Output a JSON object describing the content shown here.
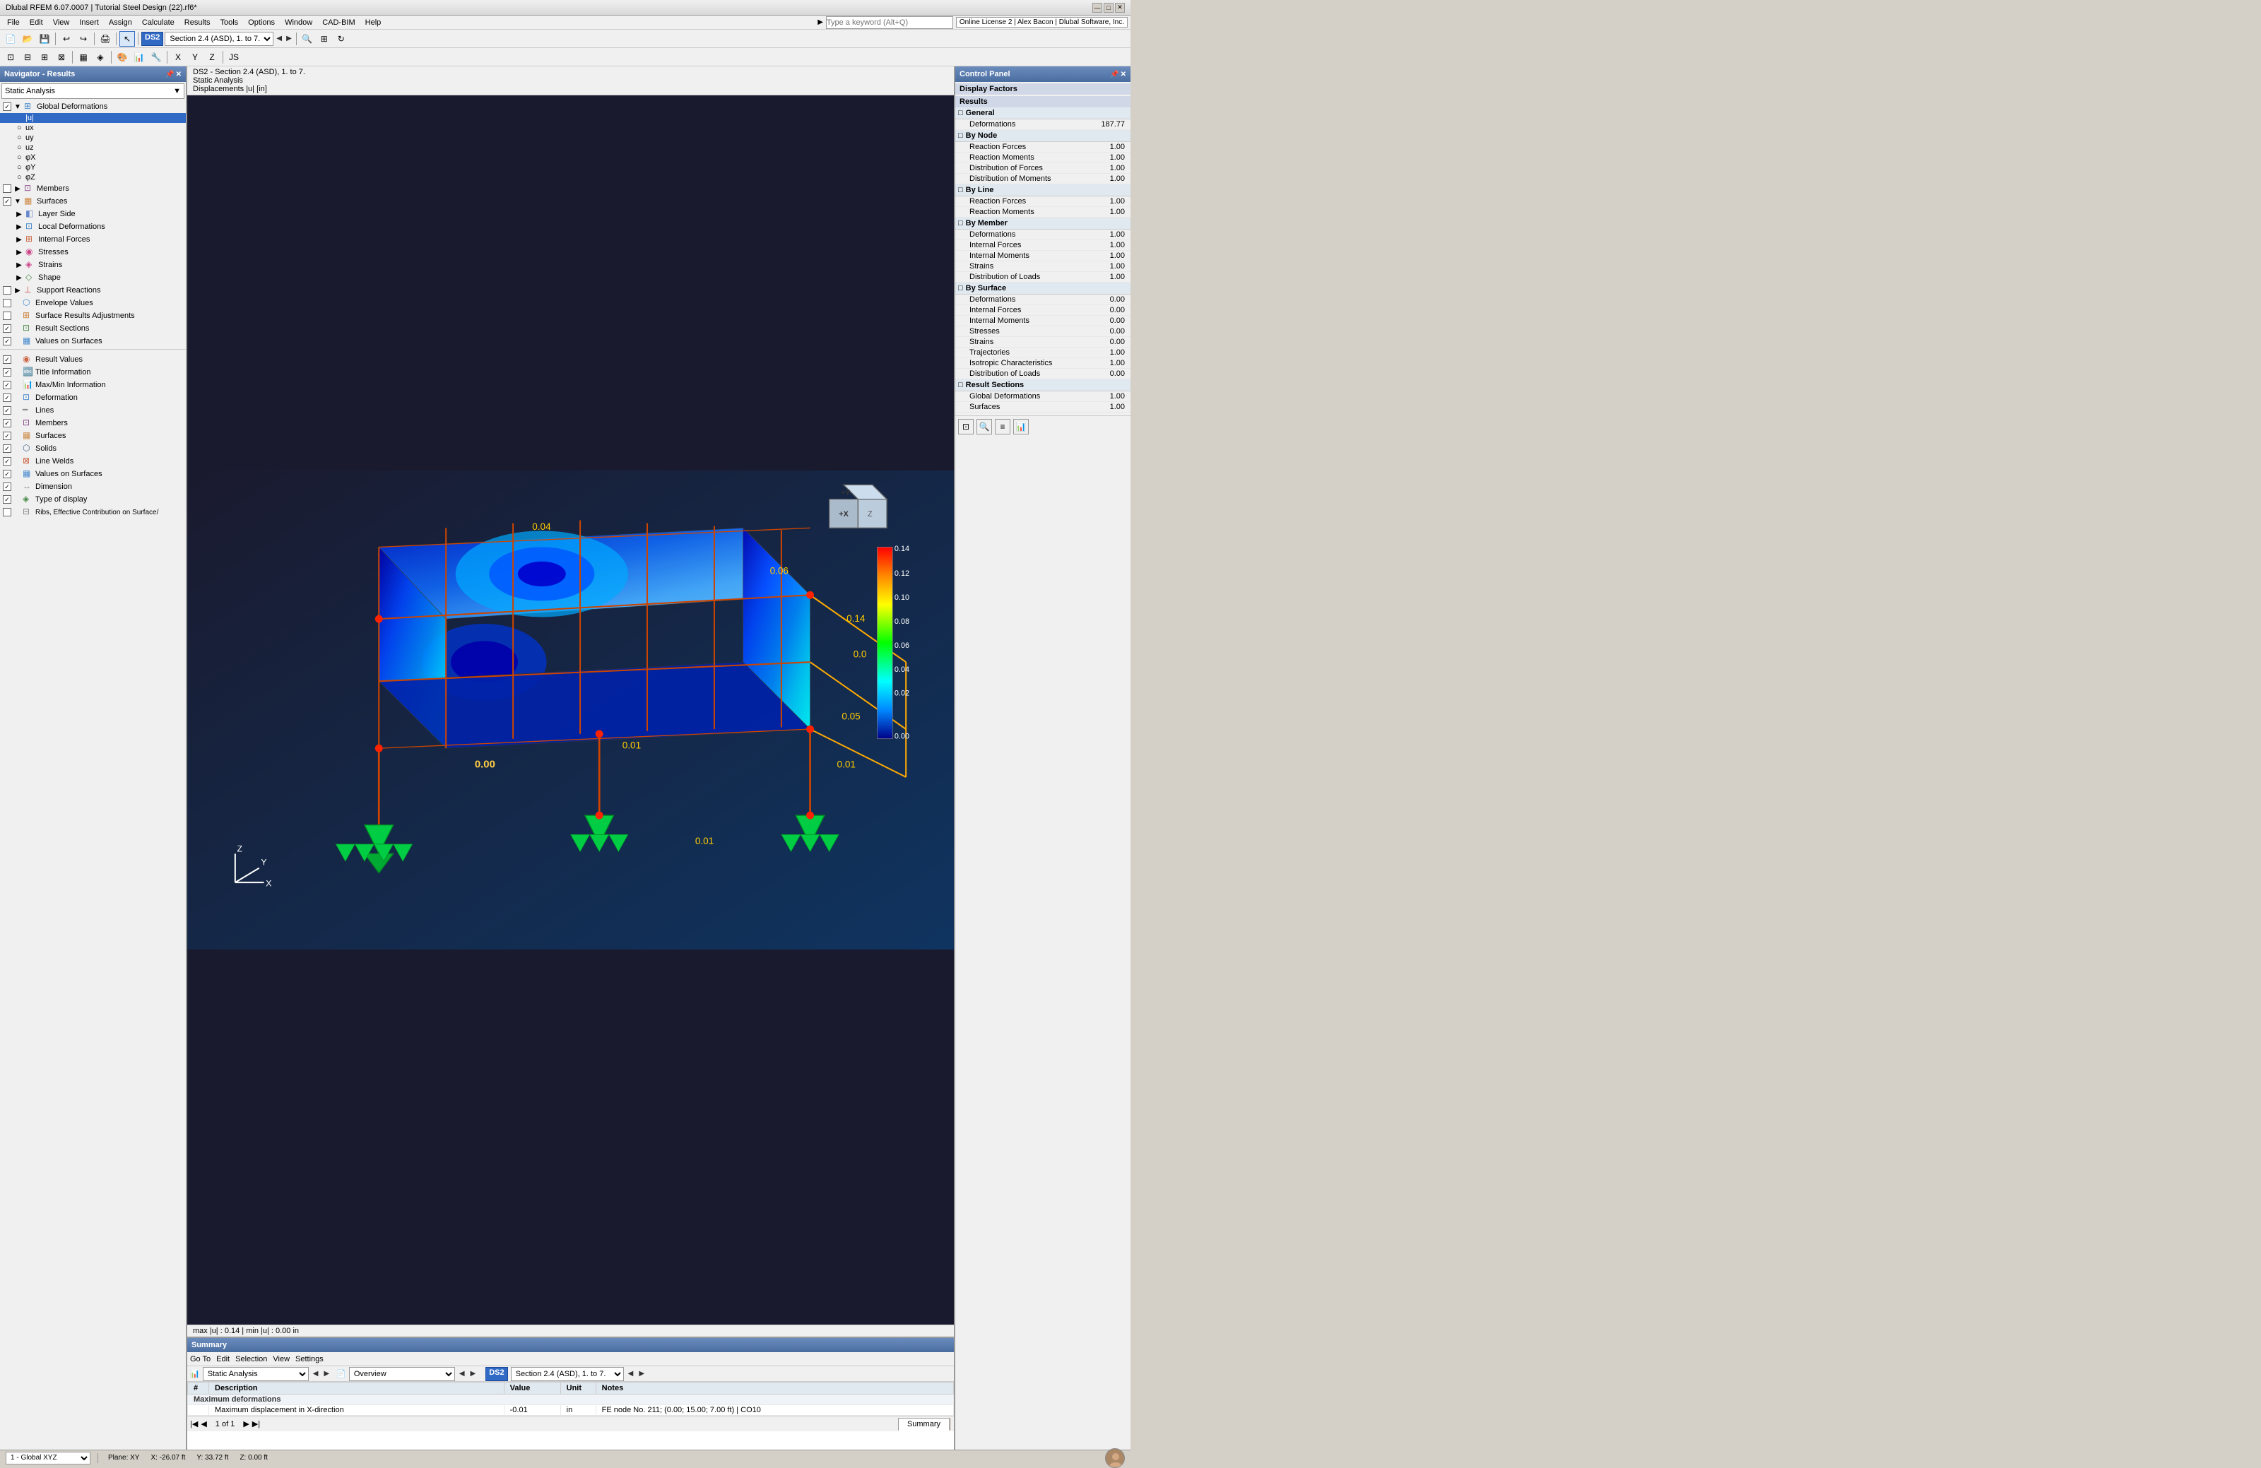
{
  "titleBar": {
    "title": "Dlubal RFEM 6.07.0007 | Tutorial Steel Design (22).rf6*",
    "winButtons": [
      "—",
      "□",
      "✕"
    ]
  },
  "menuBar": {
    "items": [
      "File",
      "Edit",
      "View",
      "Insert",
      "Assign",
      "Calculate",
      "Results",
      "Tools",
      "Options",
      "Window",
      "CAD-BIM",
      "Help"
    ]
  },
  "toolbar1": {
    "searchPlaceholder": "Type a keyword (Alt+Q)",
    "licenseInfo": "Online License 2 | Alex Bacon | Dlubal Software, Inc."
  },
  "viewportHeader": {
    "line1": "DS2 - Section 2.4 (ASD), 1. to 7.",
    "line2": "Static Analysis",
    "line3": "Displacements |u| [in]"
  },
  "viewportFooter": {
    "text": "max |u| : 0.14 | min |u| : 0.00 in"
  },
  "dsCombo": "DS2",
  "sectionCombo": "Section 2.4 (ASD), 1. to 7.",
  "navigatorTitle": "Navigator - Results",
  "navDropdown": "Static Analysis",
  "navTree": [
    {
      "id": "global-deformations",
      "label": "Global Deformations",
      "level": 0,
      "checked": true,
      "expanded": true,
      "hasExpand": true
    },
    {
      "id": "u",
      "label": "|u|",
      "level": 1,
      "radio": true,
      "selected": true
    },
    {
      "id": "ux",
      "label": "ux",
      "level": 1,
      "radio": true
    },
    {
      "id": "uy",
      "label": "uy",
      "level": 1,
      "radio": true
    },
    {
      "id": "uz",
      "label": "uz",
      "level": 1,
      "radio": true
    },
    {
      "id": "phix",
      "label": "φX",
      "level": 1,
      "radio": true
    },
    {
      "id": "phiy",
      "label": "φY",
      "level": 1,
      "radio": true
    },
    {
      "id": "phiz",
      "label": "φZ",
      "level": 1,
      "radio": true
    },
    {
      "id": "members",
      "label": "Members",
      "level": 0,
      "checked": false,
      "expanded": false,
      "hasExpand": true
    },
    {
      "id": "surfaces",
      "label": "Surfaces",
      "level": 0,
      "checked": true,
      "expanded": true,
      "hasExpand": true
    },
    {
      "id": "layer-side",
      "label": "Layer Side",
      "level": 1,
      "hasExpand": true
    },
    {
      "id": "local-deformations",
      "label": "Local Deformations",
      "level": 1,
      "hasExpand": true
    },
    {
      "id": "internal-forces",
      "label": "Internal Forces",
      "level": 1,
      "hasExpand": true
    },
    {
      "id": "stresses",
      "label": "Stresses",
      "level": 1,
      "hasExpand": true
    },
    {
      "id": "strains",
      "label": "Strains",
      "level": 1,
      "hasExpand": true
    },
    {
      "id": "shape",
      "label": "Shape",
      "level": 1,
      "hasExpand": true
    },
    {
      "id": "support-reactions",
      "label": "Support Reactions",
      "level": 0,
      "checked": false,
      "expanded": false,
      "hasExpand": true
    },
    {
      "id": "envelope-values",
      "label": "Envelope Values",
      "level": 0,
      "checked": false
    },
    {
      "id": "surface-results-adj",
      "label": "Surface Results Adjustments",
      "level": 0,
      "checked": false
    },
    {
      "id": "result-sections",
      "label": "Result Sections",
      "level": 0,
      "checked": true
    },
    {
      "id": "values-on-surfaces",
      "label": "Values on Surfaces",
      "level": 0,
      "checked": true
    },
    {
      "id": "result-values",
      "label": "Result Values",
      "level": 0,
      "checked": true,
      "separator": true
    },
    {
      "id": "title-information",
      "label": "Title Information",
      "level": 0,
      "checked": true
    },
    {
      "id": "maxmin-information",
      "label": "Max/Min Information",
      "level": 0,
      "checked": true
    },
    {
      "id": "deformation",
      "label": "Deformation",
      "level": 0,
      "checked": true
    },
    {
      "id": "lines-nav",
      "label": "Lines",
      "level": 0,
      "checked": true
    },
    {
      "id": "members-nav",
      "label": "Members",
      "level": 0,
      "checked": true
    },
    {
      "id": "surfaces-nav",
      "label": "Surfaces",
      "level": 0,
      "checked": true
    },
    {
      "id": "solids",
      "label": "Solids",
      "level": 0,
      "checked": true
    },
    {
      "id": "line-welds",
      "label": "Line Welds",
      "level": 0,
      "checked": true
    },
    {
      "id": "values-on-surfaces2",
      "label": "Values on Surfaces",
      "level": 0,
      "checked": true
    },
    {
      "id": "dimension",
      "label": "Dimension",
      "level": 0,
      "checked": true
    },
    {
      "id": "type-of-display",
      "label": "Type of display",
      "level": 0,
      "checked": true
    },
    {
      "id": "ribs",
      "label": "Ribs, Effective Contribution on Surface/",
      "level": 0,
      "checked": false
    }
  ],
  "controlPanel": {
    "title": "Control Panel",
    "subtitle1": "Display Factors",
    "subtitle2": "Results",
    "general": {
      "label": "General",
      "items": [
        {
          "name": "Deformations",
          "value": "187.77"
        }
      ]
    },
    "byNode": {
      "label": "By Node",
      "items": [
        {
          "name": "Reaction Forces",
          "value": "1.00"
        },
        {
          "name": "Reaction Moments",
          "value": "1.00"
        },
        {
          "name": "Distribution of Forces",
          "value": "1.00"
        },
        {
          "name": "Distribution of Moments",
          "value": "1.00"
        }
      ]
    },
    "byLine": {
      "label": "By Line",
      "items": [
        {
          "name": "Reaction Forces",
          "value": "1.00"
        },
        {
          "name": "Reaction Moments",
          "value": "1.00"
        }
      ]
    },
    "byMember": {
      "label": "By Member",
      "items": [
        {
          "name": "Deformations",
          "value": "1.00"
        },
        {
          "name": "Internal Forces",
          "value": "1.00"
        },
        {
          "name": "Internal Moments",
          "value": "1.00"
        },
        {
          "name": "Strains",
          "value": "1.00"
        },
        {
          "name": "Distribution of Loads",
          "value": "1.00"
        }
      ]
    },
    "bySurface": {
      "label": "By Surface",
      "items": [
        {
          "name": "Deformations",
          "value": "0.00"
        },
        {
          "name": "Internal Forces",
          "value": "0.00"
        },
        {
          "name": "Internal Moments",
          "value": "0.00"
        },
        {
          "name": "Stresses",
          "value": "0.00"
        },
        {
          "name": "Strains",
          "value": "0.00"
        },
        {
          "name": "Trajectories",
          "value": "1.00"
        },
        {
          "name": "Isotropic Characteristics",
          "value": "1.00"
        },
        {
          "name": "Distribution of Loads",
          "value": "0.00"
        }
      ]
    },
    "resultSections": {
      "label": "Result Sections",
      "items": [
        {
          "name": "Global Deformations",
          "value": "1.00"
        },
        {
          "name": "Surfaces",
          "value": "1.00"
        }
      ]
    }
  },
  "summary": {
    "title": "Summary",
    "toolbar": [
      "Go To",
      "Edit",
      "Selection",
      "View",
      "Settings"
    ],
    "navDropdown": "Static Analysis",
    "navCombo": "Overview",
    "dsLabel": "DS2",
    "sectionLabel": "Section 2.4 (ASD), 1. to 7.",
    "page": "1 of 1",
    "tab": "Summary",
    "tableHeaders": [
      "",
      "Description",
      "Value",
      "Unit",
      "Notes"
    ],
    "sectionTitle": "Maximum deformations",
    "rows": [
      {
        "desc": "Maximum displacement in X-direction",
        "value": "-0.01",
        "unit": "in",
        "notes": "FE node No. 211; (0.00; 15.00; 7.00 ft) | CO10"
      }
    ]
  },
  "statusBar": {
    "coordSystem": "1 - Global XYZ",
    "plane": "Plane: XY",
    "x": "X: -26.07 ft",
    "y": "Y: 33.72 ft",
    "z": "Z: 0.00 ft"
  },
  "scene": {
    "colorbarValues": [
      "0.14",
      "0.12",
      "0.10",
      "0.08",
      "0.06",
      "0.04",
      "0.02",
      "0.00"
    ],
    "annotations": [
      "0.04",
      "0.06",
      "0.14",
      "0.01",
      "0.05",
      "0.01",
      "0.00",
      "0.01"
    ]
  }
}
